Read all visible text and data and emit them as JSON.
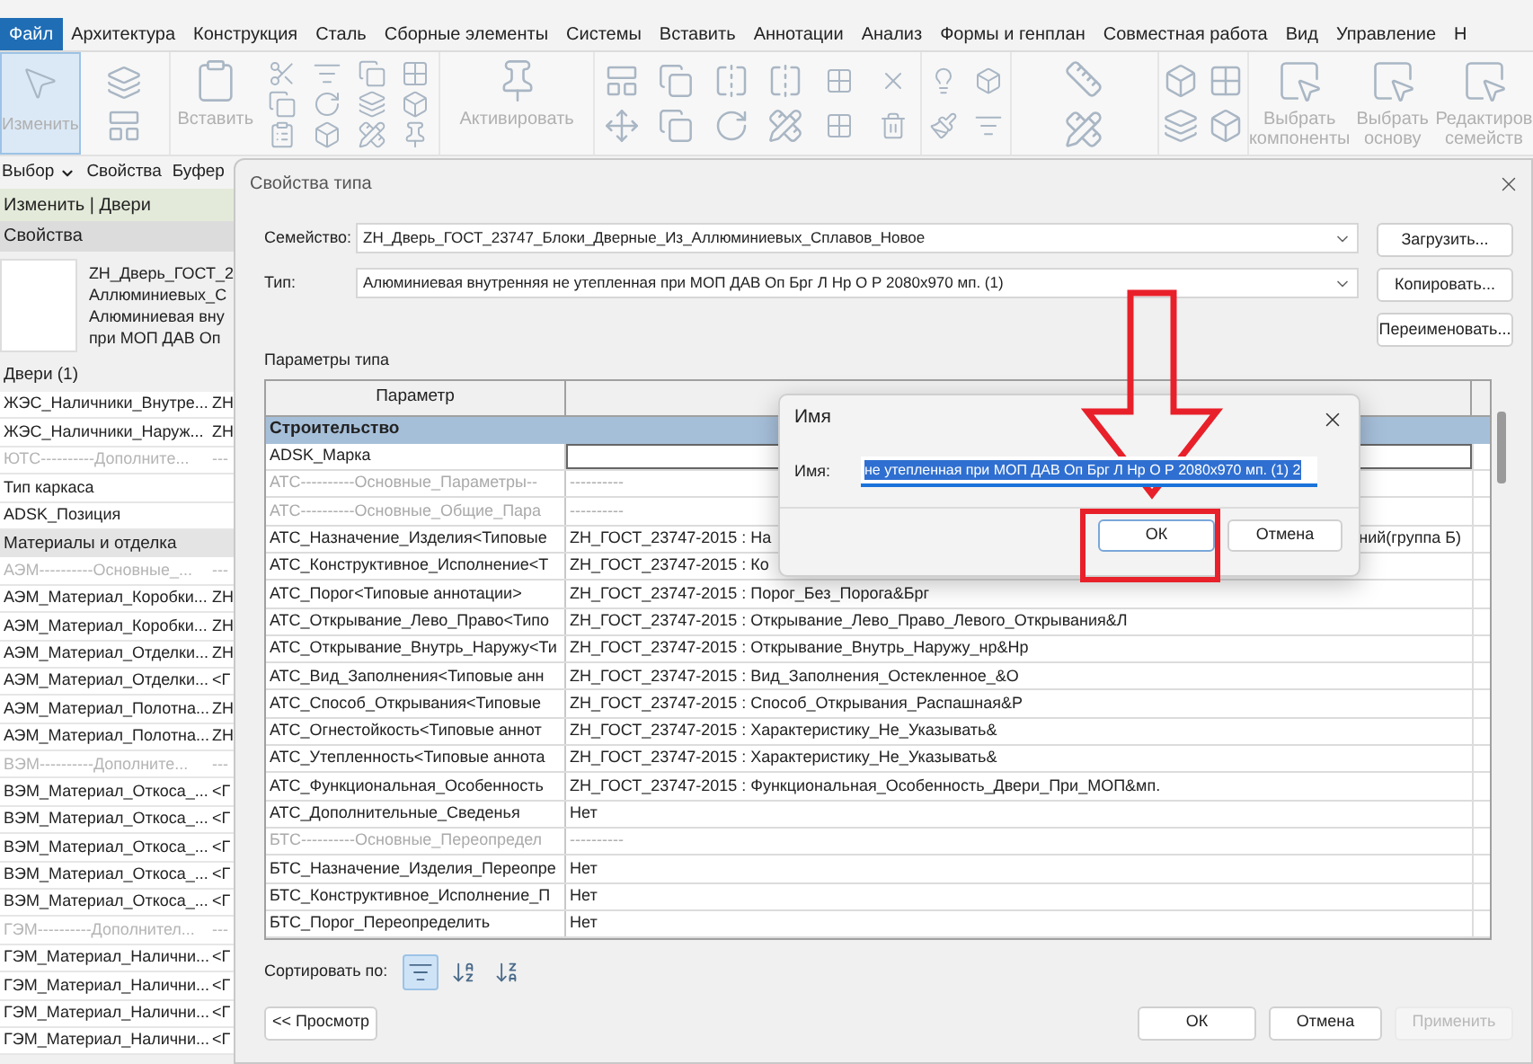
{
  "ribbon_tabs": [
    {
      "label": "Файл",
      "selected": true
    },
    {
      "label": "Архитектура",
      "selected": false
    },
    {
      "label": "Конструкция",
      "selected": false
    },
    {
      "label": "Сталь",
      "selected": false
    },
    {
      "label": "Сборные элементы",
      "selected": false
    },
    {
      "label": "Системы",
      "selected": false
    },
    {
      "label": "Вставить",
      "selected": false
    },
    {
      "label": "Аннотации",
      "selected": false
    },
    {
      "label": "Анализ",
      "selected": false
    },
    {
      "label": "Формы и генплан",
      "selected": false
    },
    {
      "label": "Совместная работа",
      "selected": false
    },
    {
      "label": "Вид",
      "selected": false
    },
    {
      "label": "Управление",
      "selected": false
    },
    {
      "label": "Н",
      "selected": false
    }
  ],
  "ribbon": {
    "modify_button": {
      "label": "Изменить",
      "selected": true
    },
    "paste_button": "Вставить",
    "activate_button": "Активировать",
    "select_components": "Выбрать компоненты",
    "select_host": "Выбрать основу",
    "edit_family": "Редактиров семейств",
    "panels": [
      "Выбор",
      "Свойства",
      "Буфер"
    ]
  },
  "context_bar": "Изменить | Двери",
  "properties": {
    "title": "Свойства",
    "preview_lines": [
      "ZH_Дверь_ГОСТ_2",
      "Аллюминиевых_С",
      "Алюминиевая вну",
      "при МОП ДАВ Оп"
    ],
    "category": "Двери (1)",
    "rows": [
      {
        "kind": "param",
        "name": "ЖЭС_Наличники_Внутре...",
        "value": "ZH"
      },
      {
        "kind": "param",
        "name": "ЖЭС_Наличники_Наруж...",
        "value": "ZH"
      },
      {
        "kind": "separator",
        "name": "ЮТС----------Дополните...",
        "value": "---"
      },
      {
        "kind": "param",
        "name": "Тип каркаса"
      },
      {
        "kind": "param",
        "name": "ADSK_Позиция"
      },
      {
        "kind": "group",
        "name": "Материалы и отделка"
      },
      {
        "kind": "separator",
        "name": "АЭМ----------Основные_...",
        "value": "---"
      },
      {
        "kind": "param",
        "name": "АЭМ_Материал_Коробки...",
        "value": "ZH"
      },
      {
        "kind": "param",
        "name": "АЭМ_Материал_Коробки...",
        "value": "ZH"
      },
      {
        "kind": "param",
        "name": "АЭМ_Материал_Отделки...",
        "value": "ZH"
      },
      {
        "kind": "param",
        "name": "АЭМ_Материал_Отделки...",
        "value": "<Г"
      },
      {
        "kind": "param",
        "name": "АЭМ_Материал_Полотна...",
        "value": "ZH"
      },
      {
        "kind": "param",
        "name": "АЭМ_Материал_Полотна...",
        "value": "ZH"
      },
      {
        "kind": "separator",
        "name": "ВЭМ----------Дополните...",
        "value": "---"
      },
      {
        "kind": "param",
        "name": "ВЭМ_Материал_Откоса_...",
        "value": "<Г"
      },
      {
        "kind": "param",
        "name": "ВЭМ_Материал_Откоса_...",
        "value": "<Г"
      },
      {
        "kind": "param",
        "name": "ВЭМ_Материал_Откоса_...",
        "value": "<Г"
      },
      {
        "kind": "param",
        "name": "ВЭМ_Материал_Откоса_...",
        "value": "<Г"
      },
      {
        "kind": "param",
        "name": "ВЭМ_Материал_Откоса_...",
        "value": "<Г"
      },
      {
        "kind": "separator",
        "name": "ГЭМ----------Дополнител...",
        "value": "---"
      },
      {
        "kind": "param",
        "name": "ГЭМ_Материал_Налични...",
        "value": "<Г"
      },
      {
        "kind": "param",
        "name": "ГЭМ_Материал_Налични...",
        "value": "<Г"
      },
      {
        "kind": "param",
        "name": "ГЭМ_Материал_Налични...",
        "value": "<Г"
      },
      {
        "kind": "param",
        "name": "ГЭМ_Материал_Налични...",
        "value": "<Г"
      }
    ]
  },
  "type_dialog": {
    "title": "Свойства типа",
    "family_label": "Семейство:",
    "family": "ZH_Дверь_ГОСТ_23747_Блоки_Дверные_Из_Аллюминиевых_Сплавов_Новое",
    "type_label": "Тип:",
    "type": "Алюминиевая внутренняя не утепленная при МОП ДАВ Оп Брг Л Нр О Р 2080x970 мп. (1)",
    "side_buttons": [
      "Загрузить...",
      "Копировать...",
      "Переименовать..."
    ],
    "params_label": "Параметры типа",
    "column_param": "Параметр",
    "rows": [
      {
        "kind": "group",
        "name": "Строительство"
      },
      {
        "kind": "input",
        "name": "ADSK_Марка"
      },
      {
        "kind": "separator",
        "name": "АТС----------Основные_Параметры--",
        "value": "----------"
      },
      {
        "kind": "separator",
        "name": "АТС----------Основные_Общие_Пара",
        "value": "----------"
      },
      {
        "kind": "param",
        "name": "АТС_Назначение_Изделия<Типовые",
        "value": "ZH_ГОСТ_23747-2015 : На",
        "value_tail": "ний(группа Б)"
      },
      {
        "kind": "param",
        "name": "АТС_Конструктивное_Исполнение<Т",
        "value": "ZH_ГОСТ_23747-2015 : Ко"
      },
      {
        "kind": "param",
        "name": "АТС_Порог<Типовые аннотации>",
        "value": "ZH_ГОСТ_23747-2015 : Порог_Без_Порога&Брг"
      },
      {
        "kind": "param",
        "name": "АТС_Открывание_Лево_Право<Типо",
        "value": "ZH_ГОСТ_23747-2015 : Открывание_Лево_Право_Левого_Открывания&Л"
      },
      {
        "kind": "param",
        "name": "АТС_Открывание_Внутрь_Наружу<Ти",
        "value": "ZH_ГОСТ_23747-2015 : Открывание_Внутрь_Наружу_нр&Нр"
      },
      {
        "kind": "param",
        "name": "АТС_Вид_Заполнения<Типовые анн",
        "value": "ZH_ГОСТ_23747-2015 : Вид_Заполнения_Остекленное_&О"
      },
      {
        "kind": "param",
        "name": "АТС_Способ_Открывания<Типовые",
        "value": "ZH_ГОСТ_23747-2015 : Способ_Открывания_Распашная&Р"
      },
      {
        "kind": "param",
        "name": "АТС_Огнестойкость<Типовые аннот",
        "value": "ZH_ГОСТ_23747-2015 : Характеристику_Не_Указывать&"
      },
      {
        "kind": "param",
        "name": "АТС_Утепленность<Типовые аннота",
        "value": "ZH_ГОСТ_23747-2015 : Характеристику_Не_Указывать&"
      },
      {
        "kind": "param",
        "name": "АТС_Функциональная_Особенность",
        "value": "ZH_ГОСТ_23747-2015 : Функциональная_Особенность_Двери_При_МОП&мп."
      },
      {
        "kind": "param",
        "name": "АТС_Дополнительные_Сведенья",
        "value": "Нет"
      },
      {
        "kind": "separator",
        "name": "БТС----------Основные_Переопредел",
        "value": "----------"
      },
      {
        "kind": "param",
        "name": "БТС_Назначение_Изделия_Переопре",
        "value": "Нет"
      },
      {
        "kind": "param",
        "name": "БТС_Конструктивное_Исполнение_П",
        "value": "Нет"
      },
      {
        "kind": "param",
        "name": "БТС_Порог_Переопределить",
        "value": "Нет"
      }
    ],
    "sort_label": "Сортировать по:",
    "sort_options": [
      {
        "kind": "group",
        "selected": true
      },
      {
        "kind": "az",
        "selected": false
      },
      {
        "kind": "za",
        "selected": false
      }
    ],
    "preview_button": "<< Просмотр",
    "buttons": [
      {
        "label": "ОК",
        "disabled": false
      },
      {
        "label": "Отмена",
        "disabled": false
      },
      {
        "label": "Применить",
        "disabled": true
      }
    ]
  },
  "name_dialog": {
    "title": "Имя",
    "label": "Имя:",
    "value": "не утепленная при МОП ДАВ Оп Брг Л Нр О Р 2080x970 мп. (1) 2",
    "ok": "ОК",
    "cancel": "Отмена"
  }
}
